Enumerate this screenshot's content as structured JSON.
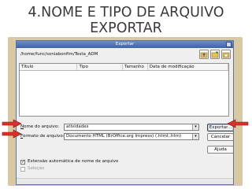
{
  "slide": {
    "title_line1": "4.NOME E TIPO DE ARQUIVO",
    "title_line2": "EXPORTAR"
  },
  "dialog": {
    "title": "Exportar",
    "path": "/home/func/soniabonfim/Testa_ADM",
    "columns": [
      "Título",
      "Tipo",
      "Tamanho",
      "Data de modificação"
    ],
    "filename_label_n": "N",
    "filename_label_rest": "ome do arquivo:",
    "filename_value": "atividades",
    "format_label_f": "F",
    "format_label_rest": "ormato de arquivo:",
    "format_value": "Documento HTML (BrOffice.org Impress) (.html;.htm)",
    "export_button": "Exportar...",
    "cancel_button": "Cancelar",
    "help_button": "Ajuda",
    "auto_extension": "Extensão automática de nome de arquivo",
    "selection": "Seleção",
    "icons": [
      "folder-up-icon",
      "new-folder-icon",
      "default-directory-icon"
    ],
    "annotation_arrow_color": "#d9302b",
    "title_bar_color": "#4e70b5"
  }
}
